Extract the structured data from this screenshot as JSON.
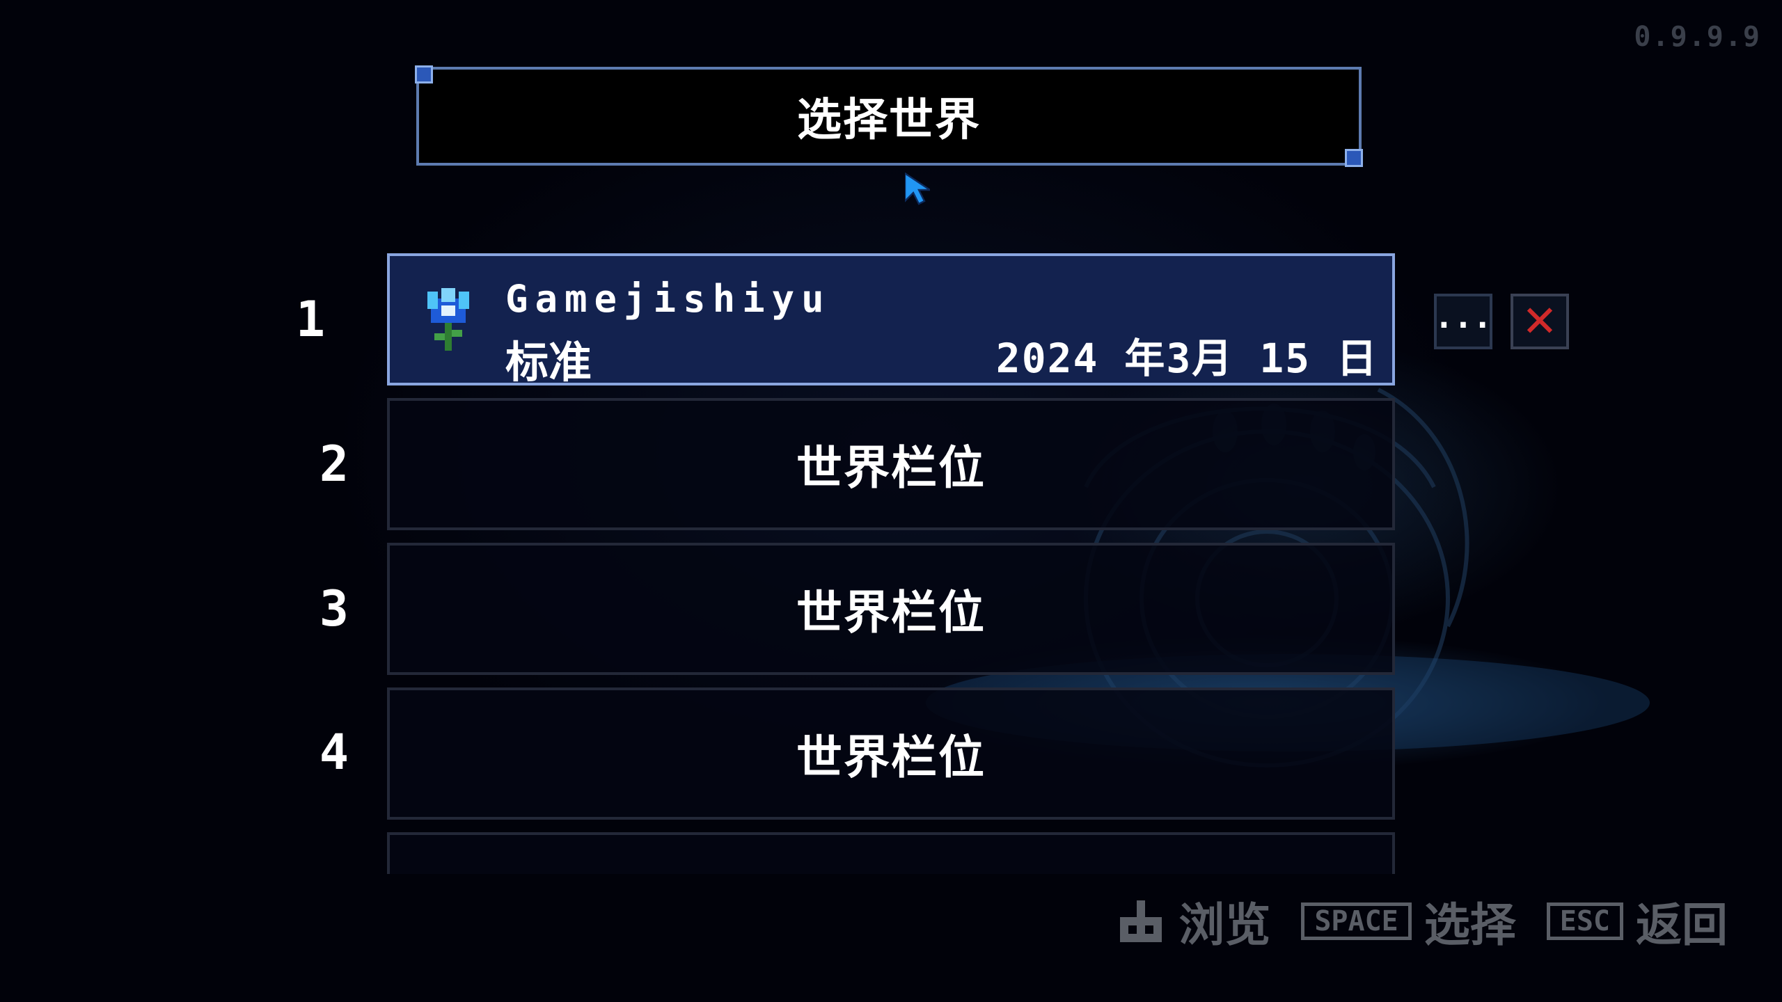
{
  "version": "0.9.9.9",
  "title": "选择世界",
  "world_slots": [
    {
      "number": "1",
      "name": "Gamejishiyu",
      "mode": "标准",
      "date": "2024 年3月 15 日",
      "selected": true
    },
    {
      "number": "2",
      "label": "世界栏位"
    },
    {
      "number": "3",
      "label": "世界栏位"
    },
    {
      "number": "4",
      "label": "世界栏位"
    }
  ],
  "actions": {
    "more": "...",
    "delete": "✕"
  },
  "hints": {
    "browse": {
      "label": "浏览"
    },
    "select": {
      "key": "SPACE",
      "label": "选择"
    },
    "back": {
      "key": "ESC",
      "label": "返回"
    }
  },
  "colors": {
    "selected_slot": "#13224f",
    "selected_border": "#8aa6e0",
    "delete_red": "#d12a2a",
    "hint_gray": "#5a5e66"
  }
}
